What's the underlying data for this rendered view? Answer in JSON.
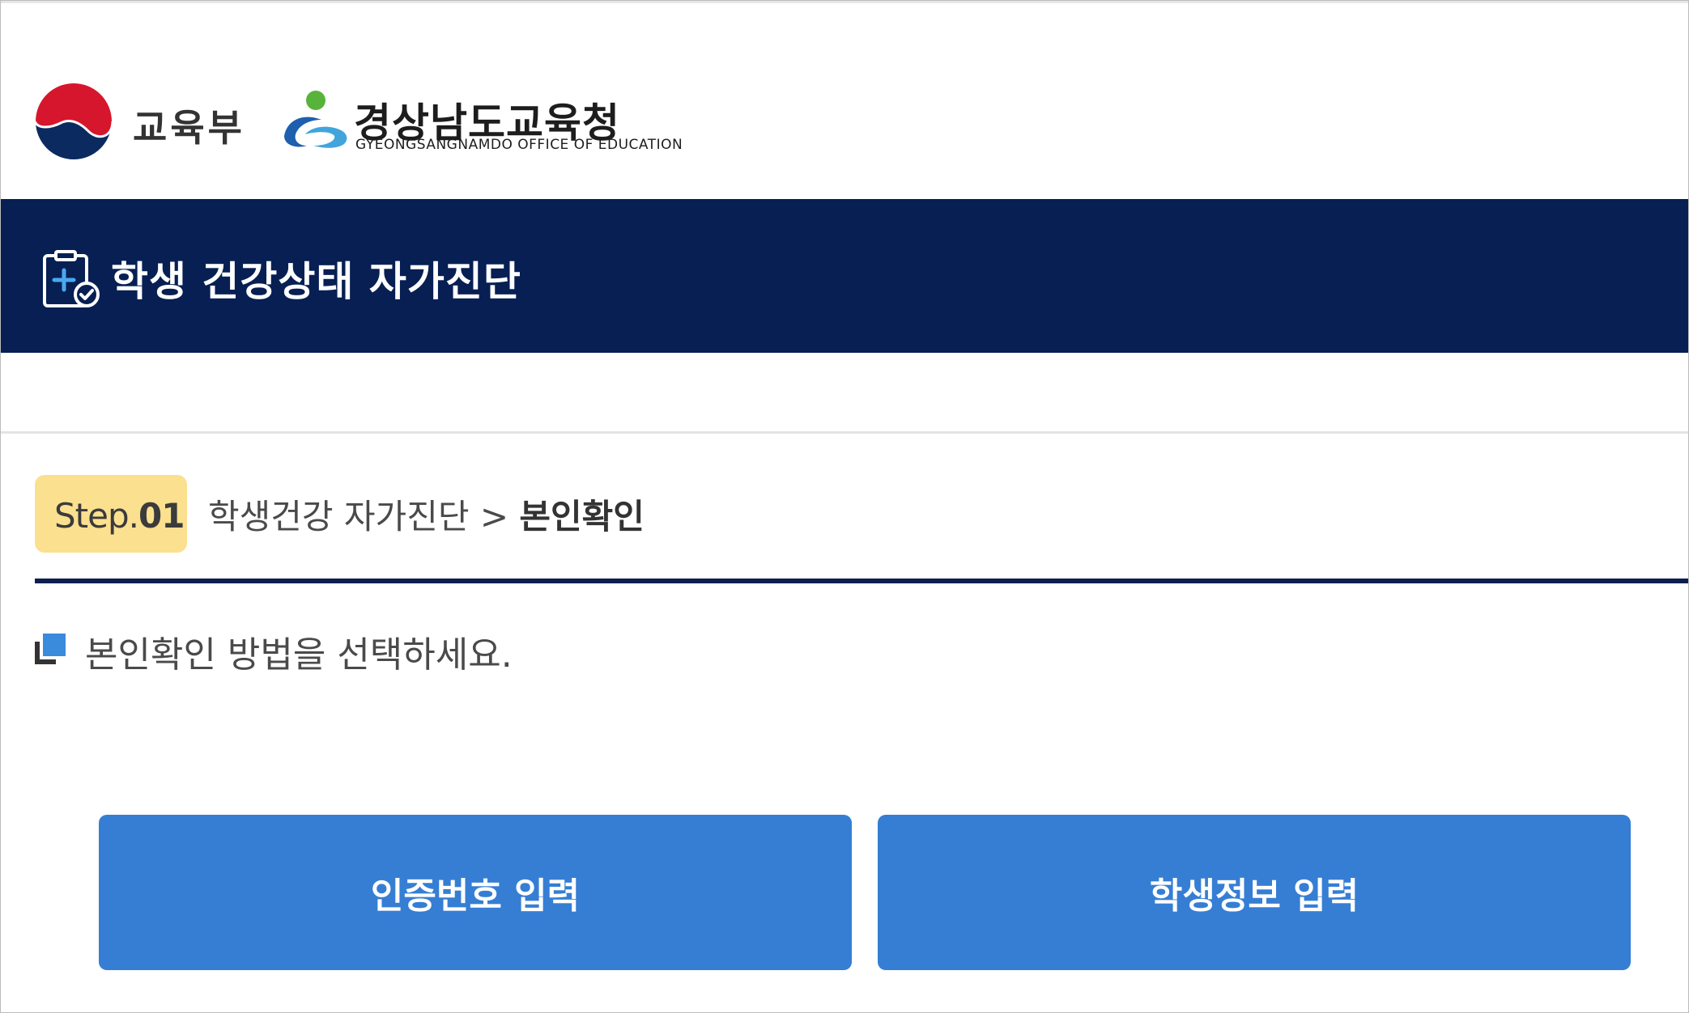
{
  "header": {
    "ministry_name": "교육부",
    "office_name": "경상남도교육청",
    "office_name_en": "GYEONGSANGNAMDO OFFICE OF EDUCATION"
  },
  "titlebar": {
    "title": "학생 건강상태 자가진단"
  },
  "step": {
    "label_prefix": "Step.",
    "label_number": "01",
    "path": "학생건강 자가진단 > ",
    "current": "본인확인"
  },
  "instruction": "본인확인 방법을 선택하세요.",
  "buttons": {
    "auth_code": "인증번호 입력",
    "student_info": "학생정보 입력"
  },
  "colors": {
    "navy": "#071f53",
    "button_blue": "#357ed4",
    "step_badge": "#fbe08f",
    "bullet_blue": "#3a8bdc"
  }
}
